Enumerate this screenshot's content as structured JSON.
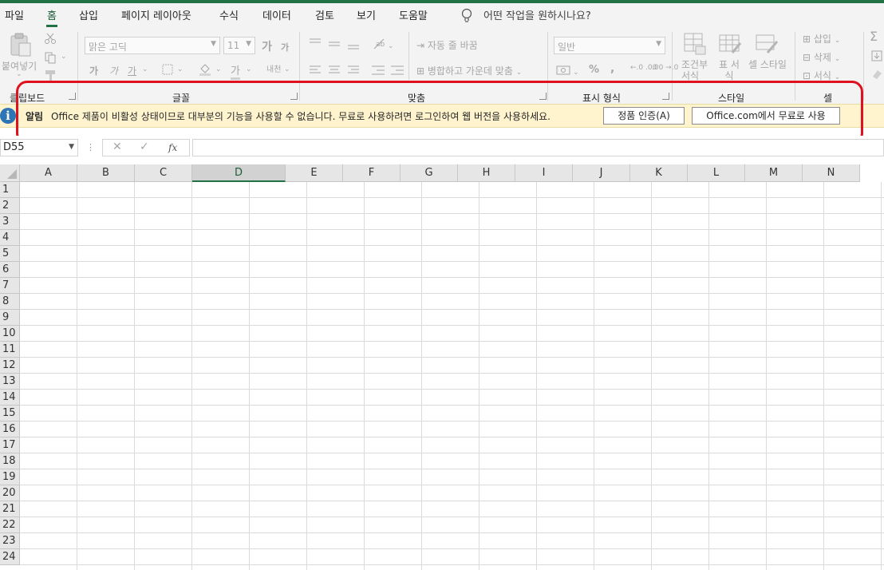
{
  "menu": {
    "tabs": [
      "파일",
      "홈",
      "삽입",
      "페이지 레이아웃",
      "수식",
      "데이터",
      "검토",
      "보기",
      "도움말"
    ],
    "active": "홈",
    "tell_me": "어떤 작업을 원하시나요?"
  },
  "ribbon": {
    "clipboard": {
      "label": "클립보드",
      "paste": "붙여넣기"
    },
    "font": {
      "label": "글꼴",
      "font_name": "맑은 고딕",
      "font_size": "11",
      "grow": "가",
      "shrink": "가",
      "bold": "가",
      "italic": "가",
      "underline": "가",
      "font_color": "가",
      "phonetic": "내천"
    },
    "alignment": {
      "label": "맞춤",
      "wrap_text": "자동 줄 바꿈",
      "merge_center": "병합하고 가운데 맞춤"
    },
    "number": {
      "label": "표시 형식",
      "format": "일반",
      "percent": "%",
      "comma": ",",
      "inc_decimal": "←.0 .00",
      "dec_decimal": ".00 →.0"
    },
    "styles": {
      "label": "스타일",
      "conditional": "조건부 서식",
      "table": "표 서식",
      "cell_style": "셀 스타일"
    },
    "cells": {
      "label": "셀",
      "insert": "삽입",
      "delete": "삭제",
      "format": "서식"
    }
  },
  "alert": {
    "title": "알림",
    "message": "Office 제품이 비활성 상태이므로 대부분의 기능을 사용할 수 없습니다. 무료로 사용하려면 로그인하여 웹 버전을 사용하세요.",
    "activate_button": "정품 인증(A)",
    "web_button": "Office.com에서 무료로 사용"
  },
  "formula_bar": {
    "name_box": "D55",
    "fx": "fx",
    "value": ""
  },
  "sheet": {
    "columns": [
      "A",
      "B",
      "C",
      "D",
      "E",
      "F",
      "G",
      "H",
      "I",
      "J",
      "K",
      "L",
      "M",
      "N"
    ],
    "selected_column": "D",
    "rows": [
      "1",
      "2",
      "3",
      "4",
      "5",
      "6",
      "7",
      "8",
      "9",
      "10",
      "11",
      "12",
      "13",
      "14",
      "15",
      "16",
      "17",
      "18",
      "19",
      "20",
      "21",
      "22",
      "23",
      "24"
    ]
  },
  "colors": {
    "excel_green": "#217346",
    "alert_bg": "#fff4ce",
    "info_blue": "#2e75b6",
    "highlight_ring": "#e0111f"
  }
}
